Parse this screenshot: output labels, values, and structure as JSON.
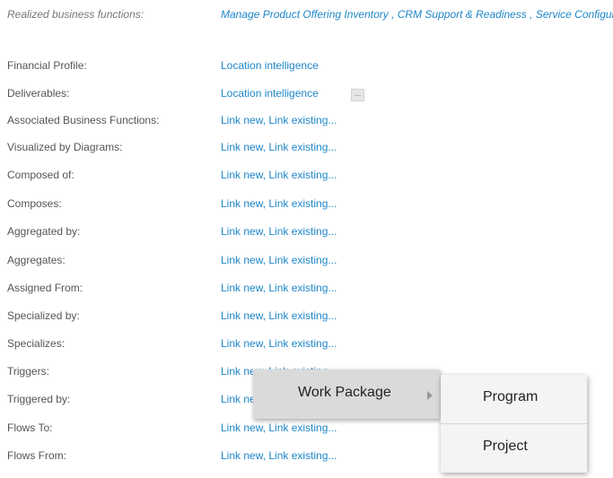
{
  "realized": {
    "label": "Realized business functions:",
    "value": "Manage Product Offering Inventory , CRM Support & Readiness , Service Configuration & Activation"
  },
  "rows": [
    {
      "label": "Financial Profile:",
      "value": "Location intelligence"
    },
    {
      "label": "Deliverables:",
      "value": "Location intelligence",
      "more": "..."
    },
    {
      "label": "Associated Business Functions:",
      "value": "Link new, Link existing..."
    },
    {
      "label": "Visualized by Diagrams:",
      "value": "Link new, Link existing..."
    },
    {
      "label": "Composed of:",
      "value": "Link new, Link existing..."
    },
    {
      "label": "Composes:",
      "value": "Link new, Link existing..."
    },
    {
      "label": "Aggregated by:",
      "value": "Link new, Link existing..."
    },
    {
      "label": "Aggregates:",
      "value": "Link new, Link existing..."
    },
    {
      "label": "Assigned From:",
      "value": "Link new, Link existing..."
    },
    {
      "label": "Specialized by:",
      "value": "Link new, Link existing..."
    },
    {
      "label": "Specializes:",
      "value": "Link new, Link existing..."
    },
    {
      "label": "Triggers:",
      "value": "Link new, Link existing..."
    },
    {
      "label": "Triggered by:",
      "value": "Link new, Link existing..."
    },
    {
      "label": "Flows To:",
      "value": "Link new, Link existing..."
    },
    {
      "label": "Flows From:",
      "value": "Link new, Link existing..."
    }
  ],
  "context_menu": {
    "item": "Work Package",
    "submenu_icon": "chevron-right-icon",
    "submenu": [
      "Program",
      "Project"
    ]
  }
}
